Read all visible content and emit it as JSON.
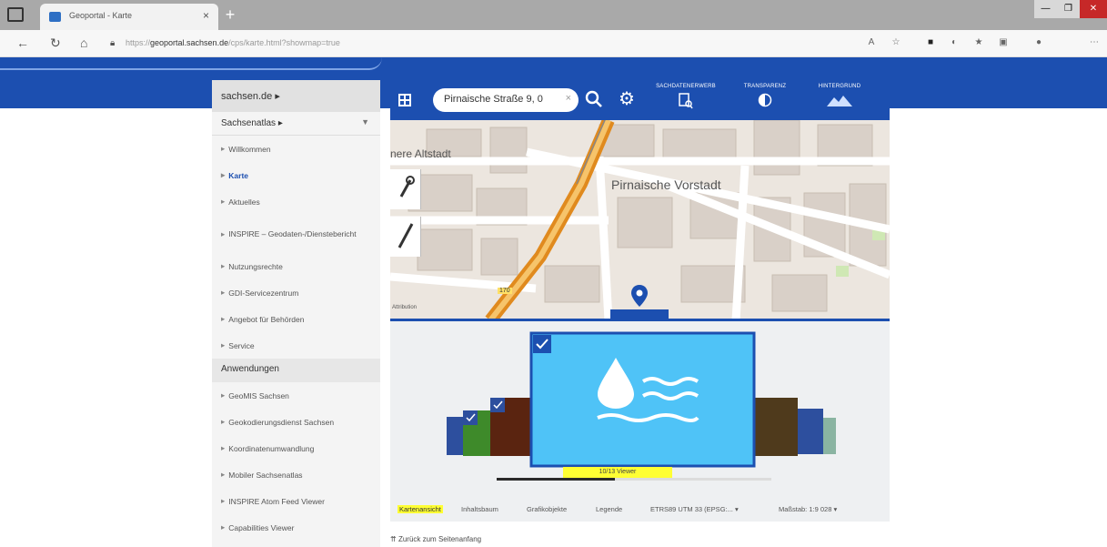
{
  "browser": {
    "tab_title": "Geoportal - Karte",
    "url_prefix": "https://",
    "url_domain": "geoportal.sachsen.de",
    "url_path": "/cps/karte.html?showmap=true",
    "close_label": "×",
    "newtab_label": "+",
    "win_min": "—",
    "win_max": "❐",
    "win_close": "✕"
  },
  "sidebar": {
    "header": "sachsen.de",
    "subheader": "Sachsenatlas",
    "items": [
      {
        "label": "Willkommen"
      },
      {
        "label": "Karte"
      },
      {
        "label": "Aktuelles"
      },
      {
        "label": "INSPIRE – Geodaten-/Dienstebericht"
      },
      {
        "label": "Nutzungsrechte"
      },
      {
        "label": "GDI-Servicezentrum"
      },
      {
        "label": "Angebot für Behörden"
      },
      {
        "label": "Service"
      }
    ],
    "section": "Anwendungen",
    "apps": [
      {
        "label": "GeoMIS Sachsen"
      },
      {
        "label": "Geokodierungsdienst Sachsen"
      },
      {
        "label": "Koordinatenumwandlung"
      },
      {
        "label": "Mobiler Sachsenatlas"
      },
      {
        "label": "INSPIRE Atom Feed Viewer"
      },
      {
        "label": "Capabilities Viewer"
      }
    ]
  },
  "toolbar": {
    "search_value": "Pirnaische Straße 9, 0",
    "search_clear": "×",
    "sachdaten": "SACHDATENERWERB",
    "transparenz": "TRANSPARENZ",
    "hintergrund": "HINTERGRUND"
  },
  "map": {
    "label_district": "Pirnaische Vorstadt",
    "label_altstadt": "nere Altstadt",
    "road_number": "170",
    "attribution": "Attribution"
  },
  "gallery": {
    "viewer_count": "10/13 Viewer",
    "progress": 0.43,
    "colors": {
      "main": "#4fc3f7",
      "left1": "#5a2410",
      "left2": "#3e8a2a",
      "right1": "#4f3a1c",
      "right2": "#2d4f9e"
    }
  },
  "tabs": {
    "kartenansicht": "Kartenansicht",
    "inhaltsbaum": "Inhaltsbaum",
    "grafikobjekte": "Grafikobjekte",
    "legende": "Legende",
    "crs": "ETRS89 UTM 33 (EPSG:...",
    "massstab": "Maßstab: 1:9 028"
  },
  "footer": {
    "back_to_top": "Zurück zum Seitenanfang"
  }
}
